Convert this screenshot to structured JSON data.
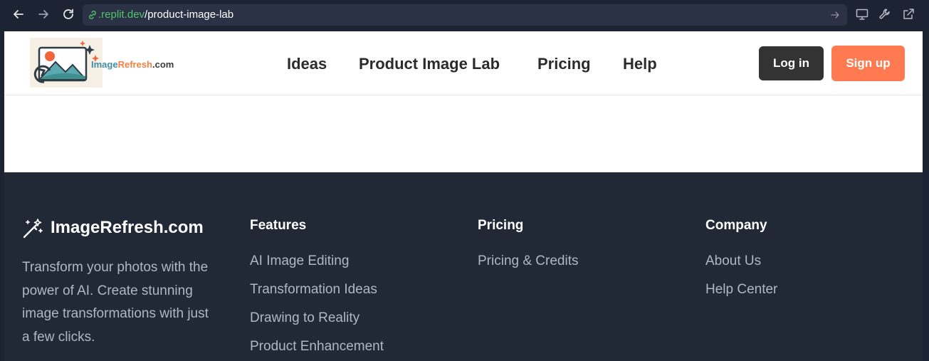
{
  "browser": {
    "url_host": ".replit.dev",
    "url_path": "/product-image-lab"
  },
  "header": {
    "logo_text_part1": "Image",
    "logo_text_part2": "Refresh",
    "logo_text_part3": ".com",
    "nav": [
      "Ideas",
      "Product Image Lab",
      "Pricing",
      "Help"
    ],
    "login_label": "Log in",
    "signup_label": "Sign up"
  },
  "footer": {
    "brand_name": "ImageRefresh.com",
    "brand_description": "Transform your photos with the power of AI. Create stunning image transformations with just a few clicks.",
    "columns": [
      {
        "title": "Features",
        "links": [
          "AI Image Editing",
          "Transformation Ideas",
          "Drawing to Reality",
          "Product Enhancement"
        ]
      },
      {
        "title": "Pricing",
        "links": [
          "Pricing & Credits"
        ]
      },
      {
        "title": "Company",
        "links": [
          "About Us",
          "Help Center"
        ]
      }
    ]
  },
  "colors": {
    "chrome_bg": "#1c2333",
    "footer_bg": "#212836",
    "login_bg": "#333333",
    "signup_bg": "#ff7a50",
    "url_host": "#4ec36a"
  }
}
